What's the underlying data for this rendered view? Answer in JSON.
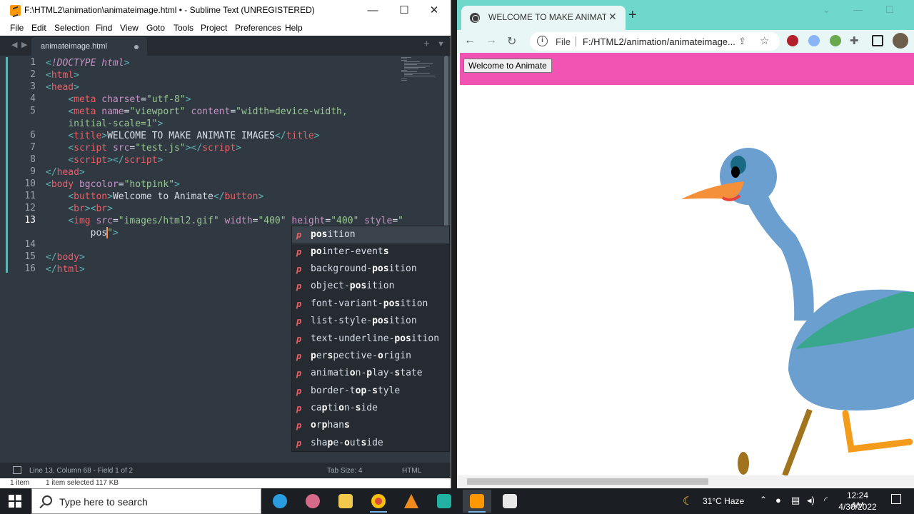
{
  "sublime": {
    "title": "F:\\HTML2\\animation\\animateimage.html • - Sublime Text (UNREGISTERED)",
    "menu": [
      "File",
      "Edit",
      "Selection",
      "Find",
      "View",
      "Goto",
      "Tools",
      "Project",
      "Preferences",
      "Help"
    ],
    "tab_name": "animateimage.html",
    "line_numbers": [
      "1",
      "2",
      "3",
      "4",
      "5",
      "",
      "6",
      "7",
      "8",
      "9",
      "10",
      "11",
      "12",
      "13",
      "",
      "14",
      "15",
      "16"
    ],
    "current_line": "13",
    "autocomplete": {
      "typed": "pos",
      "kind_letter": "p",
      "items": [
        [
          "",
          "pos",
          "i",
          "t",
          "ion"
        ],
        [
          "",
          "po",
          "",
          "inter-events",
          ""
        ],
        [
          "background-",
          "pos",
          "i",
          "t",
          "ion"
        ],
        [
          "object-",
          "pos",
          "i",
          "t",
          "ion"
        ],
        [
          "font-variant-",
          "pos",
          "i",
          "t",
          "ion"
        ],
        [
          "list-style-",
          "pos",
          "i",
          "t",
          "ion"
        ],
        [
          "text-underline-",
          "pos",
          "i",
          "t",
          "ion"
        ]
      ],
      "labels": [
        "position",
        "pointer-events",
        "background-position",
        "object-position",
        "font-variant-position",
        "list-style-position",
        "text-underline-position",
        "perspective-origin",
        "animation-play-state",
        "border-top-style",
        "caption-side",
        "orphans",
        "shape-outside"
      ]
    },
    "status": {
      "position": "Line 13, Column 68 - Field 1 of 2",
      "tab_size": "Tab Size: 4",
      "syntax": "HTML"
    },
    "explorer_strip": {
      "items": "1 item",
      "selected": "1 item selected  117 KB"
    }
  },
  "chrome": {
    "tab_title": "WELCOME TO MAKE ANIMATE IMAGES",
    "omnibox_scheme": "File",
    "url": "F:/HTML2/animation/animateimage...",
    "page_button": "Welcome to Animate",
    "page_bgcolor": "#f153b3"
  },
  "taskbar": {
    "search_placeholder": "Type here to search",
    "weather": "31°C  Haze",
    "time": "12:24 AM",
    "date": "4/30/2022",
    "apps": [
      "edge-icon",
      "paint-icon",
      "file-explorer-icon",
      "chrome-icon",
      "vlc-icon",
      "visual-studio-code-icon",
      "sublime-text-icon",
      "notepad-icon"
    ]
  }
}
